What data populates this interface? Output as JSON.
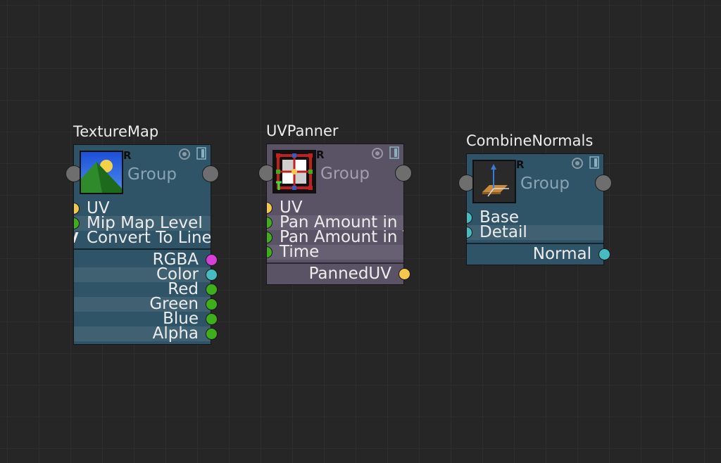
{
  "nodes": {
    "texture_map": {
      "title": "TextureMap",
      "group_label": "Group",
      "r_mark": "R",
      "inputs": [
        {
          "label": "UV",
          "type": "yellow"
        },
        {
          "label": "Mip Map Level",
          "type": "green"
        },
        {
          "label": "Convert To Linear",
          "type": "v"
        }
      ],
      "outputs": [
        {
          "label": "RGBA",
          "type": "magenta"
        },
        {
          "label": "Color",
          "type": "cyan"
        },
        {
          "label": "Red",
          "type": "green"
        },
        {
          "label": "Green",
          "type": "green"
        },
        {
          "label": "Blue",
          "type": "green"
        },
        {
          "label": "Alpha",
          "type": "green"
        }
      ],
      "v_glyph": "V",
      "thumbnail_icon": "landscape-icon"
    },
    "uv_panner": {
      "title": "UVPanner",
      "group_label": "Group",
      "r_mark": "R",
      "inputs": [
        {
          "label": "UV",
          "type": "yellow"
        },
        {
          "label": "Pan Amount in U",
          "type": "green"
        },
        {
          "label": "Pan Amount in V",
          "type": "green"
        },
        {
          "label": "Time",
          "type": "green"
        }
      ],
      "outputs": [
        {
          "label": "PannedUV",
          "type": "yellow"
        }
      ],
      "thumbnail_icon": "uv-transform-icon"
    },
    "combine_normals": {
      "title": "CombineNormals",
      "group_label": "Group",
      "r_mark": "R",
      "inputs": [
        {
          "label": "Base",
          "type": "cyan"
        },
        {
          "label": "Detail",
          "type": "cyan"
        }
      ],
      "outputs": [
        {
          "label": "Normal",
          "type": "cyan"
        }
      ],
      "thumbnail_icon": "normal-vector-icon"
    }
  },
  "colors": {
    "canvas": "#262626",
    "teal_node": "#2f5467",
    "purple_node": "#5a5366",
    "port_yellow": "#f2c94c",
    "port_green": "#3fae1b",
    "port_magenta": "#d43fd4",
    "port_cyan": "#46bcc2"
  }
}
